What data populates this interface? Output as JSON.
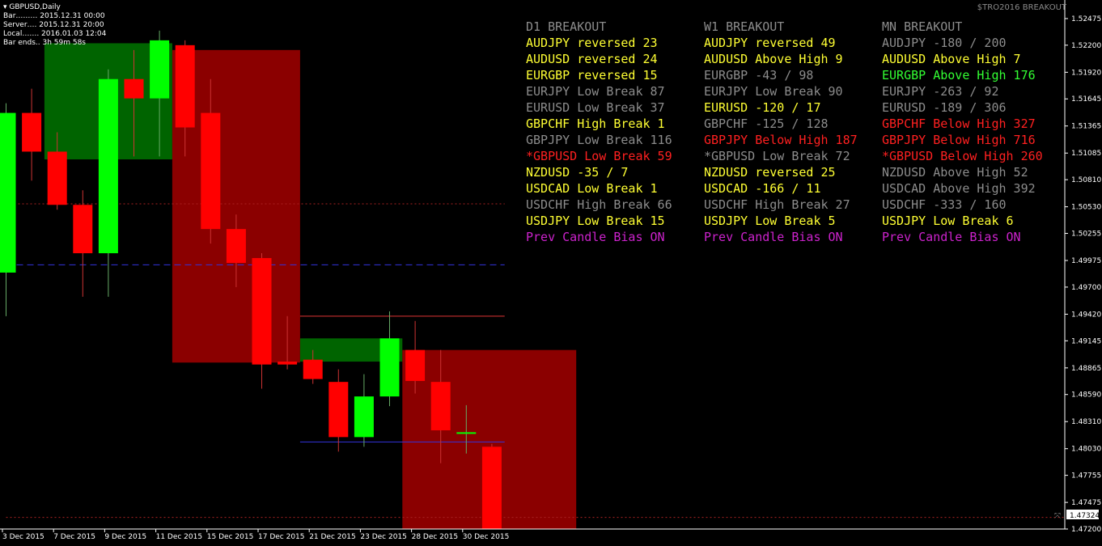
{
  "window": {
    "symbol_title": "GBPUSD,Daily"
  },
  "info_lines": [
    "Bar……… 2015.12.31 00:00",
    "Server…. 2015.12.31 20:00",
    "Local……. 2016.01.03 12:04",
    "Bar ends.. 3h 59m 58s"
  ],
  "brand_text": "$TRO2016 BREAKOUT",
  "colors": {
    "bg": "#000000",
    "bull": "#00ff00",
    "bear": "#ff0000",
    "zone_green": "#006400",
    "zone_red": "#8b0000",
    "yellow": "#ffff33",
    "gray": "#8c8c8c",
    "red_text": "#ff2020",
    "green_text": "#33ff33",
    "magenta": "#cc22cc"
  },
  "columns": [
    {
      "header": "D1 BREAKOUT",
      "rows": [
        {
          "text": "AUDJPY reversed 23",
          "color": "yellow"
        },
        {
          "text": "AUDUSD reversed 24",
          "color": "yellow"
        },
        {
          "text": "EURGBP reversed 15",
          "color": "yellow"
        },
        {
          "text": "EURJPY Low Break 87",
          "color": "gray"
        },
        {
          "text": "EURUSD Low Break 37",
          "color": "gray"
        },
        {
          "text": "GBPCHF High Break 1",
          "color": "yellow"
        },
        {
          "text": "GBPJPY Low Break 116",
          "color": "gray"
        },
        {
          "text": "*GBPUSD Low Break 59",
          "color": "red_text"
        },
        {
          "text": "NZDUSD -35 / 7",
          "color": "yellow"
        },
        {
          "text": "USDCAD Low Break 1",
          "color": "yellow"
        },
        {
          "text": "USDCHF High Break 66",
          "color": "gray"
        },
        {
          "text": "USDJPY Low Break 15",
          "color": "yellow"
        },
        {
          "text": "Prev Candle Bias ON",
          "color": "magenta"
        }
      ]
    },
    {
      "header": "W1 BREAKOUT",
      "rows": [
        {
          "text": "AUDJPY reversed 49",
          "color": "yellow"
        },
        {
          "text": "AUDUSD Above High 9",
          "color": "yellow"
        },
        {
          "text": "EURGBP -43 / 98",
          "color": "gray"
        },
        {
          "text": "EURJPY Low Break 90",
          "color": "gray"
        },
        {
          "text": "EURUSD -120 / 17",
          "color": "yellow"
        },
        {
          "text": "GBPCHF -125 / 128",
          "color": "gray"
        },
        {
          "text": "GBPJPY Below High 187",
          "color": "red_text"
        },
        {
          "text": "*GBPUSD Low Break 72",
          "color": "gray"
        },
        {
          "text": "NZDUSD reversed 25",
          "color": "yellow"
        },
        {
          "text": "USDCAD -166 / 11",
          "color": "yellow"
        },
        {
          "text": "USDCHF High Break 27",
          "color": "gray"
        },
        {
          "text": "USDJPY Low Break 5",
          "color": "yellow"
        },
        {
          "text": "Prev Candle Bias ON",
          "color": "magenta"
        }
      ]
    },
    {
      "header": "MN BREAKOUT",
      "rows": [
        {
          "text": "AUDJPY -180 / 200",
          "color": "gray"
        },
        {
          "text": "AUDUSD Above High 7",
          "color": "yellow"
        },
        {
          "text": "EURGBP Above High 176",
          "color": "green_text"
        },
        {
          "text": "EURJPY -263 / 92",
          "color": "gray"
        },
        {
          "text": "EURUSD -189 / 306",
          "color": "gray"
        },
        {
          "text": "GBPCHF Below High 327",
          "color": "red_text"
        },
        {
          "text": "GBPJPY Below High 716",
          "color": "red_text"
        },
        {
          "text": "*GBPUSD Below High 260",
          "color": "red_text"
        },
        {
          "text": "NZDUSD Above High 52",
          "color": "gray"
        },
        {
          "text": "USDCAD Above High 392",
          "color": "gray"
        },
        {
          "text": "USDCHF -333 / 160",
          "color": "gray"
        },
        {
          "text": "USDJPY Low Break 6",
          "color": "yellow"
        },
        {
          "text": "Prev Candle Bias ON",
          "color": "magenta"
        }
      ]
    }
  ],
  "chart_data": {
    "type": "candlestick",
    "symbol": "GBPUSD",
    "timeframe": "Daily",
    "ylim": [
      1.472,
      1.526
    ],
    "y_ticks": [
      "1.52475",
      "1.52200",
      "1.51920",
      "1.51645",
      "1.51365",
      "1.51085",
      "1.50810",
      "1.50530",
      "1.50255",
      "1.49975",
      "1.49700",
      "1.49420",
      "1.49145",
      "1.48865",
      "1.48590",
      "1.48310",
      "1.48030",
      "1.47755",
      "1.47475",
      "1.47200"
    ],
    "current_price": "1.47324",
    "x_ticks": [
      "3 Dec 2015",
      "7 Dec 2015",
      "9 Dec 2015",
      "11 Dec 2015",
      "15 Dec 2015",
      "17 Dec 2015",
      "21 Dec 2015",
      "23 Dec 2015",
      "28 Dec 2015",
      "30 Dec 2015"
    ],
    "candles": [
      {
        "o": 1.4985,
        "h": 1.516,
        "l": 1.494,
        "c": 1.515
      },
      {
        "o": 1.515,
        "h": 1.5175,
        "l": 1.508,
        "c": 1.511
      },
      {
        "o": 1.511,
        "h": 1.513,
        "l": 1.505,
        "c": 1.5055
      },
      {
        "o": 1.5055,
        "h": 1.507,
        "l": 1.496,
        "c": 1.5005
      },
      {
        "o": 1.5005,
        "h": 1.5195,
        "l": 1.496,
        "c": 1.5185
      },
      {
        "o": 1.5185,
        "h": 1.5215,
        "l": 1.5105,
        "c": 1.5165
      },
      {
        "o": 1.5165,
        "h": 1.5235,
        "l": 1.5105,
        "c": 1.5225
      },
      {
        "o": 1.522,
        "h": 1.5225,
        "l": 1.5105,
        "c": 1.5135
      },
      {
        "o": 1.515,
        "h": 1.5185,
        "l": 1.5015,
        "c": 1.503
      },
      {
        "o": 1.503,
        "h": 1.5045,
        "l": 1.497,
        "c": 1.4995
      },
      {
        "o": 1.5,
        "h": 1.5005,
        "l": 1.4865,
        "c": 1.489
      },
      {
        "o": 1.4893,
        "h": 1.494,
        "l": 1.4885,
        "c": 1.489
      },
      {
        "o": 1.4895,
        "h": 1.4905,
        "l": 1.487,
        "c": 1.4875
      },
      {
        "o": 1.4872,
        "h": 1.4885,
        "l": 1.48,
        "c": 1.4815
      },
      {
        "o": 1.4815,
        "h": 1.488,
        "l": 1.4805,
        "c": 1.4857
      },
      {
        "o": 1.4857,
        "h": 1.4945,
        "l": 1.4847,
        "c": 1.4917
      },
      {
        "o": 1.4905,
        "h": 1.4935,
        "l": 1.486,
        "c": 1.4873
      },
      {
        "o": 1.4872,
        "h": 1.4905,
        "l": 1.4788,
        "c": 1.4822
      },
      {
        "o": 1.482,
        "h": 1.4848,
        "l": 1.4798,
        "c": 1.482
      },
      {
        "o": 1.4805,
        "h": 1.4808,
        "l": 1.472,
        "c": 1.472
      }
    ],
    "zones": [
      {
        "x0": 1.5,
        "x1": 6.5,
        "y0": 1.5102,
        "y1": 1.5222,
        "color": "zone_green"
      },
      {
        "x0": 6.5,
        "x1": 11.5,
        "y0": 1.4892,
        "y1": 1.5215,
        "color": "zone_red"
      },
      {
        "x0": 11.5,
        "x1": 15.5,
        "y0": 1.4893,
        "y1": 1.4917,
        "color": "zone_green"
      },
      {
        "x0": 15.5,
        "x1": 22.3,
        "y0": 1.472,
        "y1": 1.4905,
        "color": "zone_red"
      }
    ],
    "lines": [
      {
        "x0": 0,
        "x1": 19.5,
        "y": 1.4993,
        "color": "#3333dd",
        "dash": "8,5"
      },
      {
        "x0": 11.5,
        "x1": 19.5,
        "y": 1.494,
        "color": "#dd3333",
        "dash": ""
      },
      {
        "x0": 11.5,
        "x1": 19.5,
        "y": 1.481,
        "color": "#3333dd",
        "dash": ""
      },
      {
        "x0": 0,
        "x1": 19.5,
        "y": 1.5056,
        "color": "#aa2222",
        "dash": "2,3"
      },
      {
        "x0": 0,
        "x1": 42,
        "y": 1.4732,
        "color": "#aa2222",
        "dash": "2,3"
      }
    ]
  }
}
